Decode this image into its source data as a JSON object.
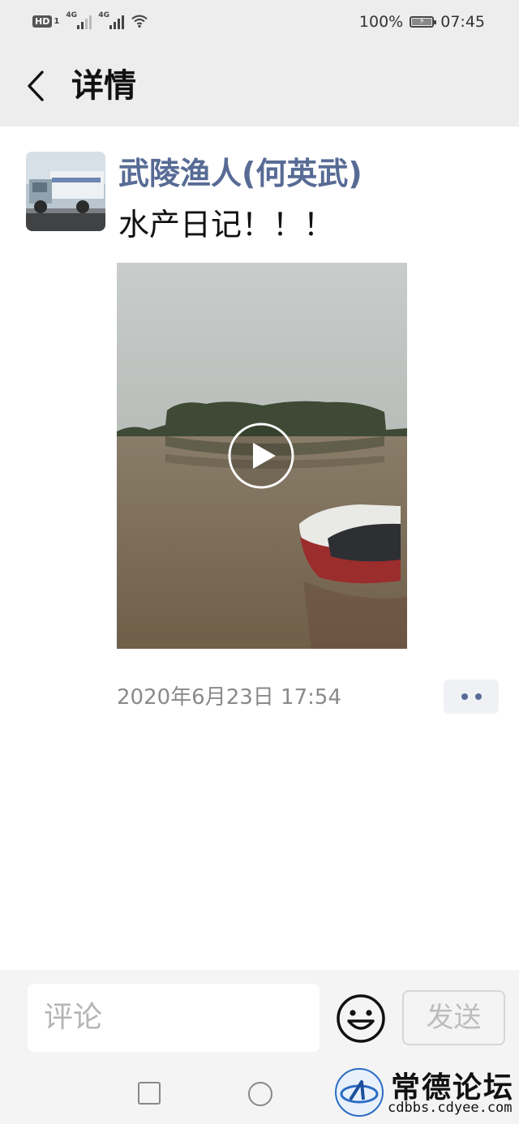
{
  "status_bar": {
    "hd_label": "HD",
    "sim1_label": "1",
    "network1": "4G",
    "network2": "4G",
    "battery": "100%",
    "time": "07:45"
  },
  "header": {
    "title": "详情",
    "back_icon": "chevron-left-icon"
  },
  "post": {
    "author": "武陵渔人(何英武)",
    "text": "水产日记！！！",
    "timestamp": "2020年6月23日 17:54",
    "video_icon": "play-icon",
    "more_icon": "more-dots-icon"
  },
  "comment_bar": {
    "placeholder": "评论",
    "emoji_icon": "smiley-icon",
    "send_label": "发送"
  },
  "watermark": {
    "title": "常德论坛",
    "url": "cdbbs.cdyee.com"
  },
  "colors": {
    "author_link": "#576b95",
    "header_bg": "#ededed",
    "timestamp": "#8a8a8a"
  }
}
